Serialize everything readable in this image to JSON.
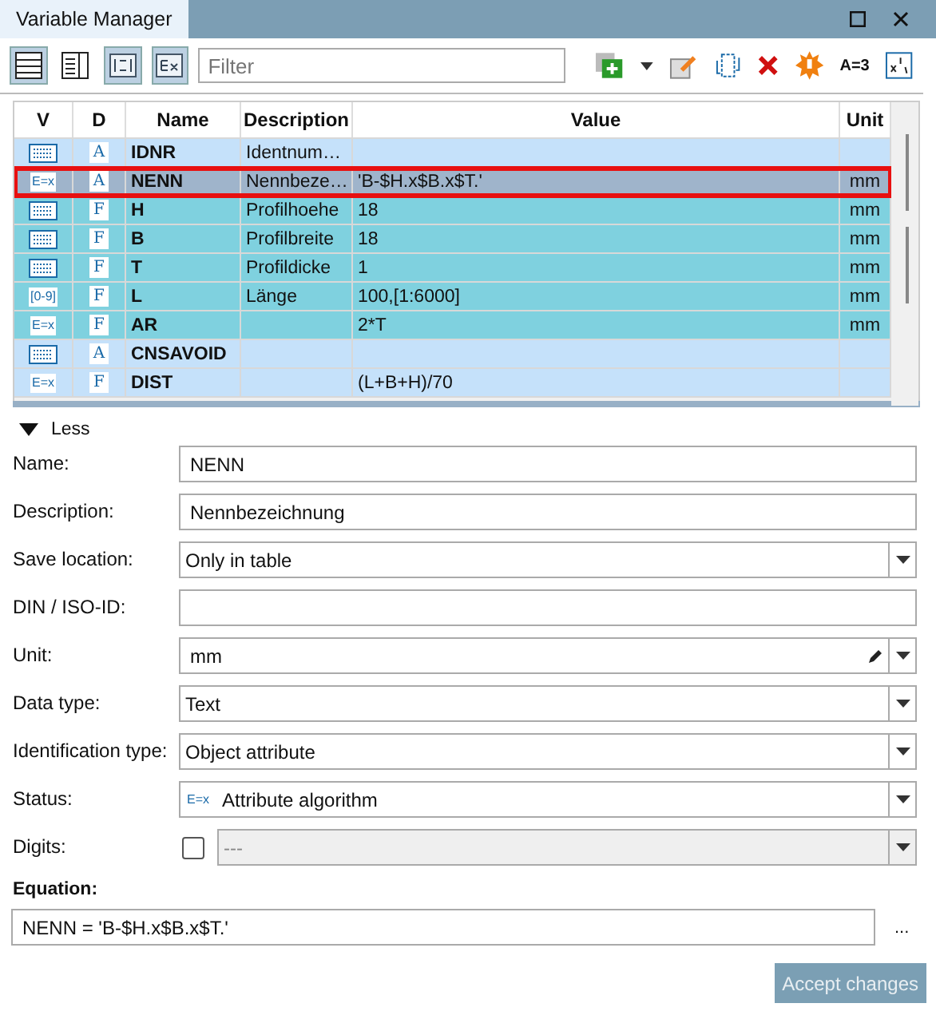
{
  "window": {
    "title": "Variable Manager"
  },
  "toolbar": {
    "view_buttons": [
      {
        "kind": "rows",
        "pressed": true
      },
      {
        "kind": "detail",
        "pressed": false
      },
      {
        "kind": "range",
        "pressed": true
      },
      {
        "kind": "expr",
        "pressed": true
      }
    ],
    "filter": {
      "placeholder": "Filter"
    },
    "action_label": "A=3"
  },
  "table": {
    "columns": [
      "V",
      "D",
      "Name",
      "Description",
      "Value",
      "Unit"
    ],
    "rows": [
      {
        "v": {
          "kind": "grid"
        },
        "d": "A",
        "name": "IDNR",
        "description": "Identnum…",
        "value": "",
        "unit": "",
        "color": "#c5e1fa",
        "selected": false
      },
      {
        "v": {
          "kind": "text",
          "text": "E=x"
        },
        "d": "A",
        "name": "NENN",
        "description": "Nennbeze…",
        "value": "'B-$H.x$B.x$T.'",
        "unit": "mm",
        "color": "#9fb4cb",
        "selected": true
      },
      {
        "v": {
          "kind": "grid"
        },
        "d": "F",
        "name": "H",
        "description": "Profilhoehe",
        "value": "18",
        "unit": "mm",
        "color": "#7fd1df",
        "selected": false
      },
      {
        "v": {
          "kind": "grid"
        },
        "d": "F",
        "name": "B",
        "description": "Profilbreite",
        "value": "18",
        "unit": "mm",
        "color": "#7fd1df",
        "selected": false
      },
      {
        "v": {
          "kind": "grid"
        },
        "d": "F",
        "name": "T",
        "description": "Profildicke",
        "value": "1",
        "unit": "mm",
        "color": "#7fd1df",
        "selected": false
      },
      {
        "v": {
          "kind": "text",
          "text": "[0-9]"
        },
        "d": "F",
        "name": "L",
        "description": "Länge",
        "value": "100,[1:6000]",
        "unit": "mm",
        "color": "#7fd1df",
        "selected": false
      },
      {
        "v": {
          "kind": "text",
          "text": "E=x"
        },
        "d": "F",
        "name": "AR",
        "description": "",
        "value": "2*T",
        "unit": "mm",
        "color": "#7fd1df",
        "selected": false
      },
      {
        "v": {
          "kind": "grid"
        },
        "d": "A",
        "name": "CNSAVOID",
        "description": "",
        "value": "",
        "unit": "",
        "color": "#c5e1fa",
        "selected": false
      },
      {
        "v": {
          "kind": "text",
          "text": "E=x"
        },
        "d": "F",
        "name": "DIST",
        "description": "",
        "value": "(L+B+H)/70",
        "unit": "",
        "color": "#c5e1fa",
        "selected": false
      }
    ]
  },
  "less_toggle": {
    "label": "Less",
    "expanded": true
  },
  "form": [
    {
      "kind": "text",
      "label": "Name:",
      "value": "NENN"
    },
    {
      "kind": "text",
      "label": "Description:",
      "value": "Nennbezeichnung"
    },
    {
      "kind": "select",
      "label": "Save location:",
      "value": "Only in table"
    },
    {
      "kind": "text",
      "label": "DIN / ISO-ID:"
    },
    {
      "kind": "unit",
      "label": "Unit:",
      "value": "mm"
    },
    {
      "kind": "select",
      "label": "Data type:",
      "value": "Text"
    },
    {
      "kind": "select",
      "label": "Identification type:",
      "value": "Object attribute"
    },
    {
      "kind": "status",
      "label": "Status:",
      "value": "Attribute algorithm",
      "icon_text": "E=x"
    },
    {
      "kind": "digits",
      "label": "Digits:",
      "value": "---",
      "checked": false
    }
  ],
  "equation": {
    "label": "Equation:",
    "value": "NENN = 'B-$H.x$B.x$T.'",
    "more": "..."
  },
  "accept_button": {
    "label": "Accept changes",
    "disabled": true
  }
}
